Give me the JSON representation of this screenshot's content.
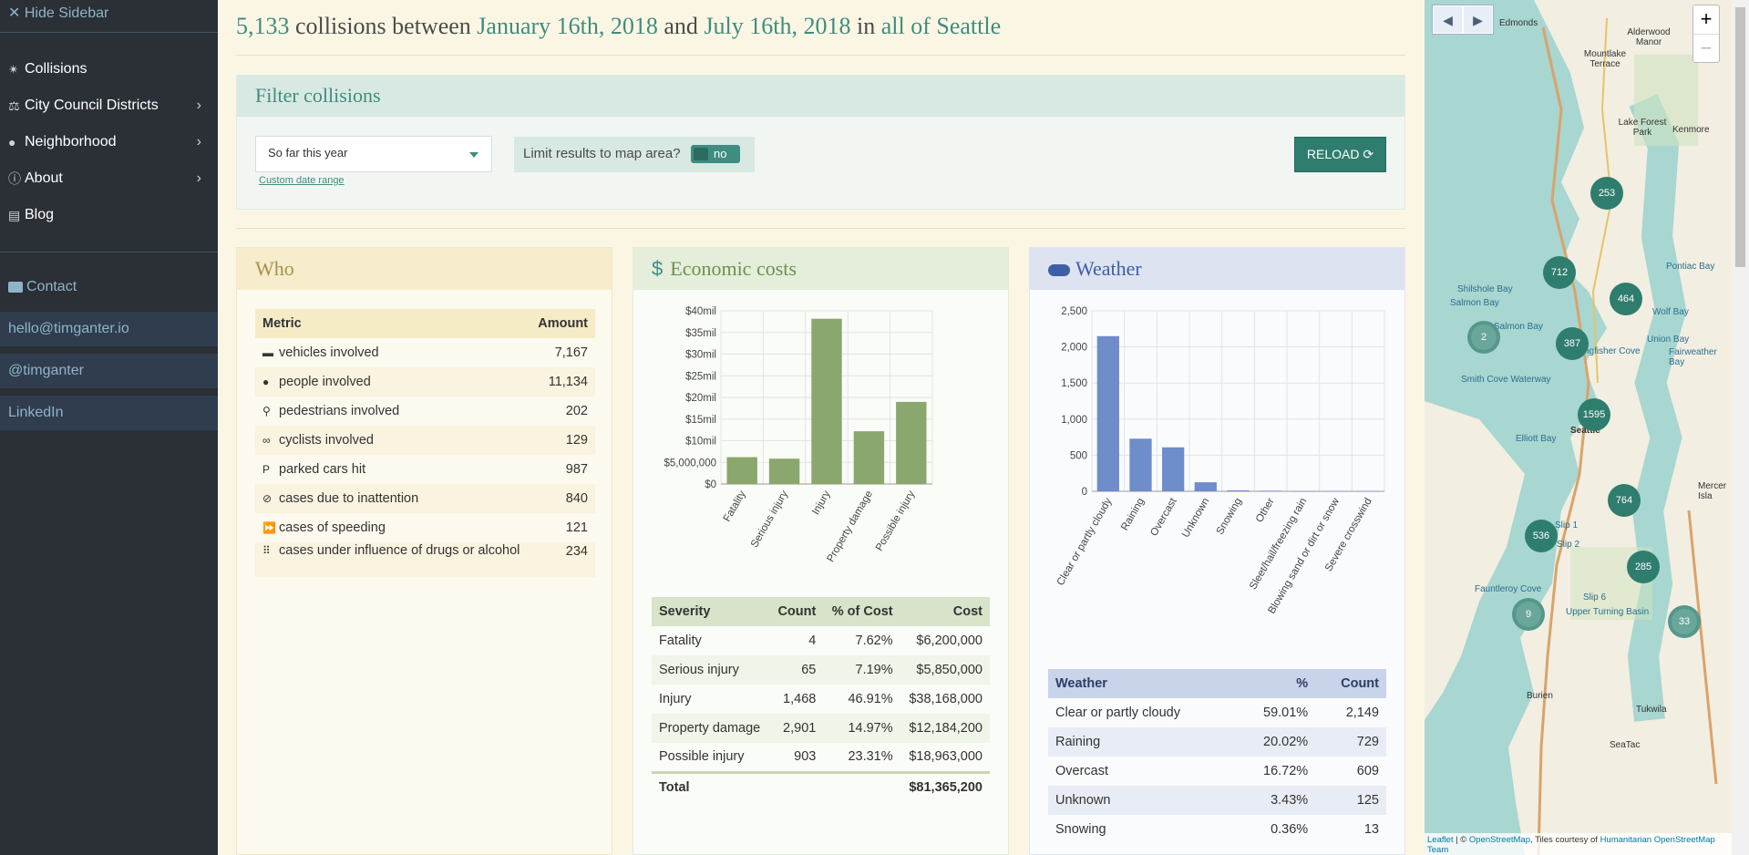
{
  "sidebar": {
    "hide_label": "✕ Hide Sidebar",
    "items": [
      {
        "label": "Collisions",
        "icon": "collisions-icon",
        "glyph": "✴"
      },
      {
        "label": "City Council Districts",
        "icon": "gavel-icon",
        "glyph": "⚖"
      },
      {
        "label": "Neighborhood",
        "icon": "map-pin-icon",
        "glyph": "●"
      },
      {
        "label": "About",
        "icon": "info-icon",
        "glyph": "ⓘ"
      },
      {
        "label": "Blog",
        "icon": "newspaper-icon",
        "glyph": "▤"
      }
    ],
    "contact_label": "Contact",
    "links": [
      "hello@timganter.io",
      "@timganter",
      "LinkedIn"
    ]
  },
  "header": {
    "count": "5,133",
    "text1": " collisions between ",
    "start_date": "January 16th, 2018",
    "text2": " and ",
    "end_date": "July 16th, 2018",
    "text3": " in ",
    "area": "all of Seattle"
  },
  "filter": {
    "title": "Filter collisions",
    "range_value": "So far this year",
    "custom_link": "Custom date range",
    "limit_label": "Limit results to map area?",
    "toggle_value": "no",
    "reload_label": "RELOAD ⟳"
  },
  "who": {
    "title": "Who",
    "headers": {
      "metric": "Metric",
      "amount": "Amount"
    },
    "rows": [
      {
        "icon": "car-icon",
        "glyph": "▬",
        "label": "vehicles involved",
        "value": "7,167"
      },
      {
        "icon": "person-icon",
        "glyph": "●",
        "label": "people involved",
        "value": "11,134"
      },
      {
        "icon": "pedestrian-icon",
        "glyph": "⚲",
        "label": "pedestrians involved",
        "value": "202"
      },
      {
        "icon": "bicycle-icon",
        "glyph": "∞",
        "label": "cyclists involved",
        "value": "129"
      },
      {
        "icon": "parking-icon",
        "glyph": "P",
        "label": "parked cars hit",
        "value": "987"
      },
      {
        "icon": "eye-slash-icon",
        "glyph": "⊘",
        "label": "cases due to inattention",
        "value": "840"
      },
      {
        "icon": "fast-forward-icon",
        "glyph": "⏩",
        "label": "cases of speeding",
        "value": "121"
      },
      {
        "icon": "braille-icon",
        "glyph": "⠿",
        "label": "cases under influence of drugs or alcohol",
        "value": "234"
      }
    ]
  },
  "econ": {
    "title": "Economic costs",
    "icon": "dollar-icon",
    "headers": {
      "severity": "Severity",
      "count": "Count",
      "pct": "% of Cost",
      "cost": "Cost"
    },
    "rows": [
      {
        "severity": "Fatality",
        "count": "4",
        "pct": "7.62%",
        "cost": "$6,200,000"
      },
      {
        "severity": "Serious injury",
        "count": "65",
        "pct": "7.19%",
        "cost": "$5,850,000"
      },
      {
        "severity": "Injury",
        "count": "1,468",
        "pct": "46.91%",
        "cost": "$38,168,000"
      },
      {
        "severity": "Property damage",
        "count": "2,901",
        "pct": "14.97%",
        "cost": "$12,184,200"
      },
      {
        "severity": "Possible injury",
        "count": "903",
        "pct": "23.31%",
        "cost": "$18,963,000"
      }
    ],
    "total_label": "Total",
    "total_value": "$81,365,200"
  },
  "weather": {
    "title": "Weather",
    "icon": "cloud-icon",
    "headers": {
      "weather": "Weather",
      "pct": "%",
      "count": "Count"
    },
    "rows": [
      {
        "weather": "Clear or partly cloudy",
        "pct": "59.01%",
        "count": "2,149"
      },
      {
        "weather": "Raining",
        "pct": "20.02%",
        "count": "729"
      },
      {
        "weather": "Overcast",
        "pct": "16.72%",
        "count": "609"
      },
      {
        "weather": "Unknown",
        "pct": "3.43%",
        "count": "125"
      },
      {
        "weather": "Snowing",
        "pct": "0.36%",
        "count": "13"
      }
    ]
  },
  "chart_data": [
    {
      "type": "bar",
      "categories": [
        "Fatality",
        "Serious injury",
        "Injury",
        "Property damage",
        "Possible injury"
      ],
      "values": [
        6200000,
        5850000,
        38168000,
        12184200,
        18963000
      ],
      "ylim": [
        0,
        40000000
      ],
      "yticks": [
        0,
        5000000,
        10000000,
        15000000,
        20000000,
        25000000,
        30000000,
        35000000,
        40000000
      ],
      "ytick_labels": [
        "$0",
        "$5,000,000",
        "$10mil",
        "$15mil",
        "$20mil",
        "$25mil",
        "$30mil",
        "$35mil",
        "$40mil"
      ],
      "color": "#8aa76d",
      "grid": true
    },
    {
      "type": "bar",
      "categories": [
        "Clear or partly cloudy",
        "Raining",
        "Overcast",
        "Unknown",
        "Snowing",
        "Other",
        "Sleet/hail/freezing rain",
        "Blowing sand or dirt or snow",
        "Severe crosswind"
      ],
      "values": [
        2149,
        729,
        609,
        125,
        13,
        8,
        3,
        1,
        1
      ],
      "ylim": [
        0,
        2500
      ],
      "yticks": [
        0,
        500,
        1000,
        1500,
        2000,
        2500
      ],
      "ytick_labels": [
        "0",
        "500",
        "1,000",
        "1,500",
        "2,000",
        "2,500"
      ],
      "color": "#6f8ccb",
      "grid": true
    }
  ],
  "map": {
    "clusters": [
      "253",
      "712",
      "464",
      "2",
      "387",
      "1595",
      "764",
      "536",
      "285",
      "9",
      "33"
    ],
    "places": [
      "Edmonds",
      "Alderwood Manor",
      "Mountlake Terrace",
      "Lake Forest Park",
      "Kenmore",
      "Pontiac Bay",
      "Wolf Bay",
      "Union Bay",
      "Shilshole Bay",
      "Salmon Bay",
      "Smith Cove Waterway",
      "Kingfisher Cove",
      "Fairweather Bay",
      "Seattle",
      "Elliott Bay",
      "Mercer Isla",
      "Slip 1",
      "Slip 2",
      "Slip 6",
      "Fauntleroy Cove",
      "Upper Turning Basin",
      "Burien",
      "Tukwila",
      "SeaTac"
    ],
    "attribution_leaflet": "Leaflet",
    "attribution_text": " | © ",
    "attribution_osm": "OpenStreetMap",
    "attribution_text2": ", Tiles courtesy of ",
    "attribution_hum": "Humanitarian OpenStreetMap Team",
    "zoom_in": "+",
    "zoom_out": "−"
  },
  "colors": {
    "accent": "#3f8d7f",
    "sidebar": "#2b2f36",
    "econ_bar": "#8aa76d",
    "weather_bar": "#6f8ccb"
  }
}
